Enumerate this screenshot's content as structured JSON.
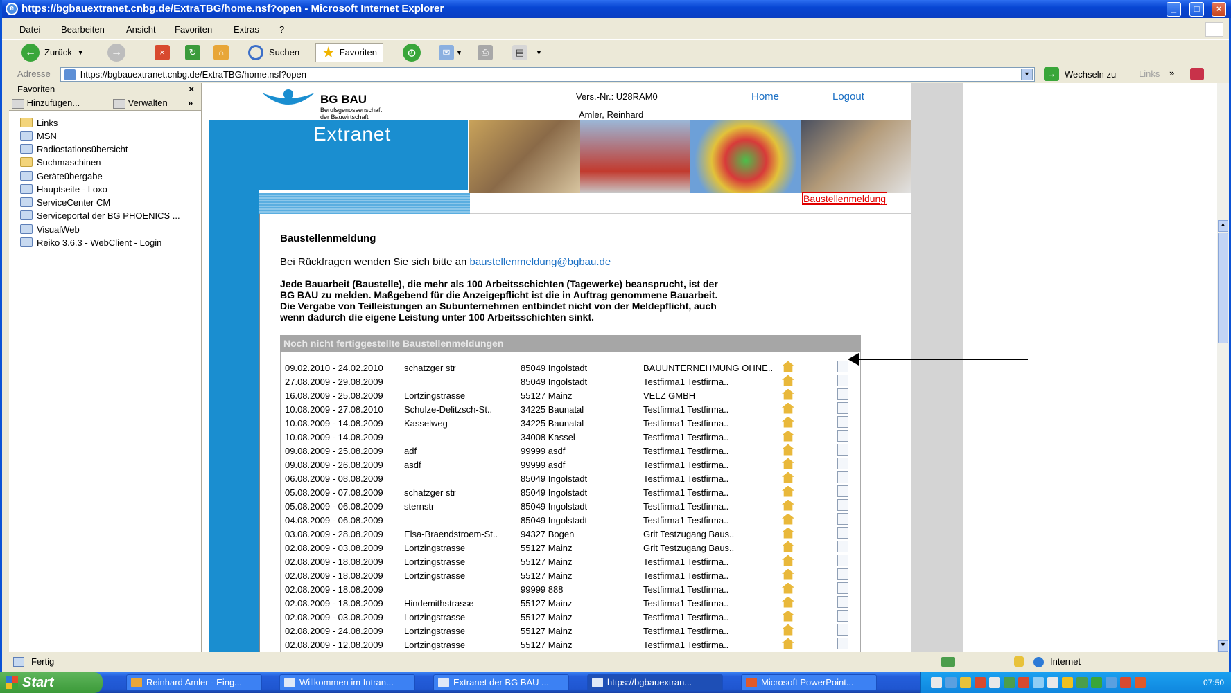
{
  "window": {
    "title": "https://bgbauextranet.cnbg.de/ExtraTBG/home.nsf?open - Microsoft Internet Explorer"
  },
  "menu": [
    "Datei",
    "Bearbeiten",
    "Ansicht",
    "Favoriten",
    "Extras",
    "?"
  ],
  "toolbar": {
    "back": "Zurück",
    "search": "Suchen",
    "favorites": "Favoriten"
  },
  "address": {
    "label": "Adresse",
    "url": "https://bgbauextranet.cnbg.de/ExtraTBG/home.nsf?open",
    "go": "Wechseln zu",
    "links": "Links"
  },
  "favorites_pane": {
    "title": "Favoriten",
    "add": "Hinzufügen...",
    "manage": "Verwalten",
    "items": [
      {
        "label": "Links",
        "kind": "folder"
      },
      {
        "label": "MSN",
        "kind": "page"
      },
      {
        "label": "Radiostationsübersicht",
        "kind": "page"
      },
      {
        "label": "Suchmaschinen",
        "kind": "folder"
      },
      {
        "label": "Geräteübergabe",
        "kind": "page"
      },
      {
        "label": "Hauptseite - Loxo",
        "kind": "page"
      },
      {
        "label": "ServiceCenter CM",
        "kind": "page"
      },
      {
        "label": "Serviceportal der BG PHOENICS ...",
        "kind": "page"
      },
      {
        "label": "VisualWeb",
        "kind": "page"
      },
      {
        "label": "Reiko 3.6.3 - WebClient - Login",
        "kind": "page"
      }
    ]
  },
  "page": {
    "logo_title": "BG BAU",
    "logo_sub1": "Berufsgenossenschaft",
    "logo_sub2": "der Bauwirtschaft",
    "extranet": "Extranet",
    "version": "Vers.-Nr.: U28RAM0",
    "user": "Amler, Reinhard",
    "nav_home": "Home",
    "nav_logout": "Logout",
    "section_link": "Baustellenmeldung",
    "heading": "Baustellenmeldung",
    "contact_text": "Bei Rückfragen wenden Sie sich bitte an",
    "contact_email": "baustellenmeldung@bgbau.de",
    "notice_1": "Jede Bauarbeit (Baustelle), die mehr als 100 Arbeitsschichten (Tagewerke) beansprucht, ist der",
    "notice_2": "BG BAU zu melden. Maßgebend für die Anzeigepflicht ist die in Auftrag genommene Bauarbeit.",
    "notice_3": "Die Vergabe von Teilleistungen an Subunternehmen entbindet nicht von der Meldepflicht, auch",
    "notice_4": "wenn dadurch die eigene Leistung unter 100 Arbeitsschichten sinkt.",
    "table_title": "Noch nicht fertiggestellte Baustellenmeldungen",
    "rows": [
      [
        "09.02.2010 - 24.02.2010",
        "schatzger str",
        "85049 Ingolstadt",
        "BAUUNTERNEHMUNG OHNE.."
      ],
      [
        "27.08.2009 - 29.08.2009",
        "",
        "85049 Ingolstadt",
        "Testfirma1 Testfirma.."
      ],
      [
        "16.08.2009 - 25.08.2009",
        "Lortzingstrasse",
        "55127 Mainz",
        "VELZ GMBH"
      ],
      [
        "10.08.2009 - 27.08.2010",
        "Schulze-Delitzsch-St..",
        "34225 Baunatal",
        "Testfirma1 Testfirma.."
      ],
      [
        "10.08.2009 - 14.08.2009",
        "Kasselweg",
        "34225 Baunatal",
        "Testfirma1 Testfirma.."
      ],
      [
        "10.08.2009 - 14.08.2009",
        "",
        "34008 Kassel",
        "Testfirma1 Testfirma.."
      ],
      [
        "09.08.2009 - 25.08.2009",
        "adf",
        "99999 asdf",
        "Testfirma1 Testfirma.."
      ],
      [
        "09.08.2009 - 26.08.2009",
        "asdf",
        "99999 asdf",
        "Testfirma1 Testfirma.."
      ],
      [
        "06.08.2009 - 08.08.2009",
        "",
        "85049 Ingolstadt",
        "Testfirma1 Testfirma.."
      ],
      [
        "05.08.2009 - 07.08.2009",
        "schatzger str",
        "85049 Ingolstadt",
        "Testfirma1 Testfirma.."
      ],
      [
        "05.08.2009 - 06.08.2009",
        "sternstr",
        "85049 Ingolstadt",
        "Testfirma1 Testfirma.."
      ],
      [
        "04.08.2009 - 06.08.2009",
        "",
        "85049 Ingolstadt",
        "Testfirma1 Testfirma.."
      ],
      [
        "03.08.2009 - 28.08.2009",
        "Elsa-Braendstroem-St..",
        "94327 Bogen",
        "Grit Testzugang Baus.."
      ],
      [
        "02.08.2009 - 03.08.2009",
        "Lortzingstrasse",
        "55127 Mainz",
        "Grit Testzugang Baus.."
      ],
      [
        "02.08.2009 - 18.08.2009",
        "Lortzingstrasse",
        "55127 Mainz",
        "Testfirma1 Testfirma.."
      ],
      [
        "02.08.2009 - 18.08.2009",
        "Lortzingstrasse",
        "55127 Mainz",
        "Testfirma1 Testfirma.."
      ],
      [
        "02.08.2009 - 18.08.2009",
        "",
        "99999 888",
        "Testfirma1 Testfirma.."
      ],
      [
        "02.08.2009 - 18.08.2009",
        "Hindemithstrasse",
        "55127 Mainz",
        "Testfirma1 Testfirma.."
      ],
      [
        "02.08.2009 - 03.08.2009",
        "Lortzingstrasse",
        "55127 Mainz",
        "Testfirma1 Testfirma.."
      ],
      [
        "02.08.2009 - 24.08.2009",
        "Lortzingstrasse",
        "55127 Mainz",
        "Testfirma1 Testfirma.."
      ],
      [
        "02.08.2009 - 12.08.2009",
        "Lortzingstrasse",
        "55127 Mainz",
        "Testfirma1 Testfirma.."
      ]
    ]
  },
  "status": {
    "text": "Fertig",
    "zone": "Internet"
  },
  "taskbar": {
    "start": "Start",
    "tasks": [
      "Reinhard Amler - Eing...",
      "Willkommen im Intran...",
      "Extranet der BG BAU ...",
      "https://bgbauextran...",
      "Microsoft PowerPoint..."
    ],
    "clock": "07:50"
  },
  "colors": {
    "title_blue": "#0a46d6",
    "page_blue": "#1a8ed0",
    "link_red": "#e00000",
    "link_blue": "#1a6fc4"
  }
}
